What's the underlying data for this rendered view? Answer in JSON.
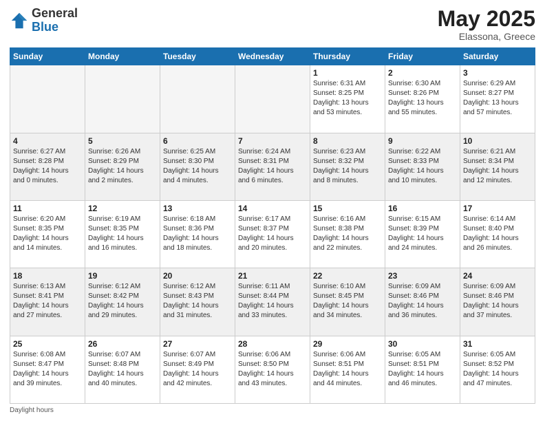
{
  "header": {
    "logo_general": "General",
    "logo_blue": "Blue",
    "month_title": "May 2025",
    "location": "Elassona, Greece"
  },
  "weekdays": [
    "Sunday",
    "Monday",
    "Tuesday",
    "Wednesday",
    "Thursday",
    "Friday",
    "Saturday"
  ],
  "footer": {
    "daylight_label": "Daylight hours"
  },
  "weeks": [
    [
      {
        "day": "",
        "empty": true
      },
      {
        "day": "",
        "empty": true
      },
      {
        "day": "",
        "empty": true
      },
      {
        "day": "",
        "empty": true
      },
      {
        "day": "1",
        "sunrise": "6:31 AM",
        "sunset": "8:25 PM",
        "daylight": "13 hours and 53 minutes."
      },
      {
        "day": "2",
        "sunrise": "6:30 AM",
        "sunset": "8:26 PM",
        "daylight": "13 hours and 55 minutes."
      },
      {
        "day": "3",
        "sunrise": "6:29 AM",
        "sunset": "8:27 PM",
        "daylight": "13 hours and 57 minutes."
      }
    ],
    [
      {
        "day": "4",
        "sunrise": "6:27 AM",
        "sunset": "8:28 PM",
        "daylight": "14 hours and 0 minutes.",
        "shaded": true
      },
      {
        "day": "5",
        "sunrise": "6:26 AM",
        "sunset": "8:29 PM",
        "daylight": "14 hours and 2 minutes.",
        "shaded": true
      },
      {
        "day": "6",
        "sunrise": "6:25 AM",
        "sunset": "8:30 PM",
        "daylight": "14 hours and 4 minutes.",
        "shaded": true
      },
      {
        "day": "7",
        "sunrise": "6:24 AM",
        "sunset": "8:31 PM",
        "daylight": "14 hours and 6 minutes.",
        "shaded": true
      },
      {
        "day": "8",
        "sunrise": "6:23 AM",
        "sunset": "8:32 PM",
        "daylight": "14 hours and 8 minutes.",
        "shaded": true
      },
      {
        "day": "9",
        "sunrise": "6:22 AM",
        "sunset": "8:33 PM",
        "daylight": "14 hours and 10 minutes.",
        "shaded": true
      },
      {
        "day": "10",
        "sunrise": "6:21 AM",
        "sunset": "8:34 PM",
        "daylight": "14 hours and 12 minutes.",
        "shaded": true
      }
    ],
    [
      {
        "day": "11",
        "sunrise": "6:20 AM",
        "sunset": "8:35 PM",
        "daylight": "14 hours and 14 minutes."
      },
      {
        "day": "12",
        "sunrise": "6:19 AM",
        "sunset": "8:35 PM",
        "daylight": "14 hours and 16 minutes."
      },
      {
        "day": "13",
        "sunrise": "6:18 AM",
        "sunset": "8:36 PM",
        "daylight": "14 hours and 18 minutes."
      },
      {
        "day": "14",
        "sunrise": "6:17 AM",
        "sunset": "8:37 PM",
        "daylight": "14 hours and 20 minutes."
      },
      {
        "day": "15",
        "sunrise": "6:16 AM",
        "sunset": "8:38 PM",
        "daylight": "14 hours and 22 minutes."
      },
      {
        "day": "16",
        "sunrise": "6:15 AM",
        "sunset": "8:39 PM",
        "daylight": "14 hours and 24 minutes."
      },
      {
        "day": "17",
        "sunrise": "6:14 AM",
        "sunset": "8:40 PM",
        "daylight": "14 hours and 26 minutes."
      }
    ],
    [
      {
        "day": "18",
        "sunrise": "6:13 AM",
        "sunset": "8:41 PM",
        "daylight": "14 hours and 27 minutes.",
        "shaded": true
      },
      {
        "day": "19",
        "sunrise": "6:12 AM",
        "sunset": "8:42 PM",
        "daylight": "14 hours and 29 minutes.",
        "shaded": true
      },
      {
        "day": "20",
        "sunrise": "6:12 AM",
        "sunset": "8:43 PM",
        "daylight": "14 hours and 31 minutes.",
        "shaded": true
      },
      {
        "day": "21",
        "sunrise": "6:11 AM",
        "sunset": "8:44 PM",
        "daylight": "14 hours and 33 minutes.",
        "shaded": true
      },
      {
        "day": "22",
        "sunrise": "6:10 AM",
        "sunset": "8:45 PM",
        "daylight": "14 hours and 34 minutes.",
        "shaded": true
      },
      {
        "day": "23",
        "sunrise": "6:09 AM",
        "sunset": "8:46 PM",
        "daylight": "14 hours and 36 minutes.",
        "shaded": true
      },
      {
        "day": "24",
        "sunrise": "6:09 AM",
        "sunset": "8:46 PM",
        "daylight": "14 hours and 37 minutes.",
        "shaded": true
      }
    ],
    [
      {
        "day": "25",
        "sunrise": "6:08 AM",
        "sunset": "8:47 PM",
        "daylight": "14 hours and 39 minutes."
      },
      {
        "day": "26",
        "sunrise": "6:07 AM",
        "sunset": "8:48 PM",
        "daylight": "14 hours and 40 minutes."
      },
      {
        "day": "27",
        "sunrise": "6:07 AM",
        "sunset": "8:49 PM",
        "daylight": "14 hours and 42 minutes."
      },
      {
        "day": "28",
        "sunrise": "6:06 AM",
        "sunset": "8:50 PM",
        "daylight": "14 hours and 43 minutes."
      },
      {
        "day": "29",
        "sunrise": "6:06 AM",
        "sunset": "8:51 PM",
        "daylight": "14 hours and 44 minutes."
      },
      {
        "day": "30",
        "sunrise": "6:05 AM",
        "sunset": "8:51 PM",
        "daylight": "14 hours and 46 minutes."
      },
      {
        "day": "31",
        "sunrise": "6:05 AM",
        "sunset": "8:52 PM",
        "daylight": "14 hours and 47 minutes."
      }
    ]
  ]
}
